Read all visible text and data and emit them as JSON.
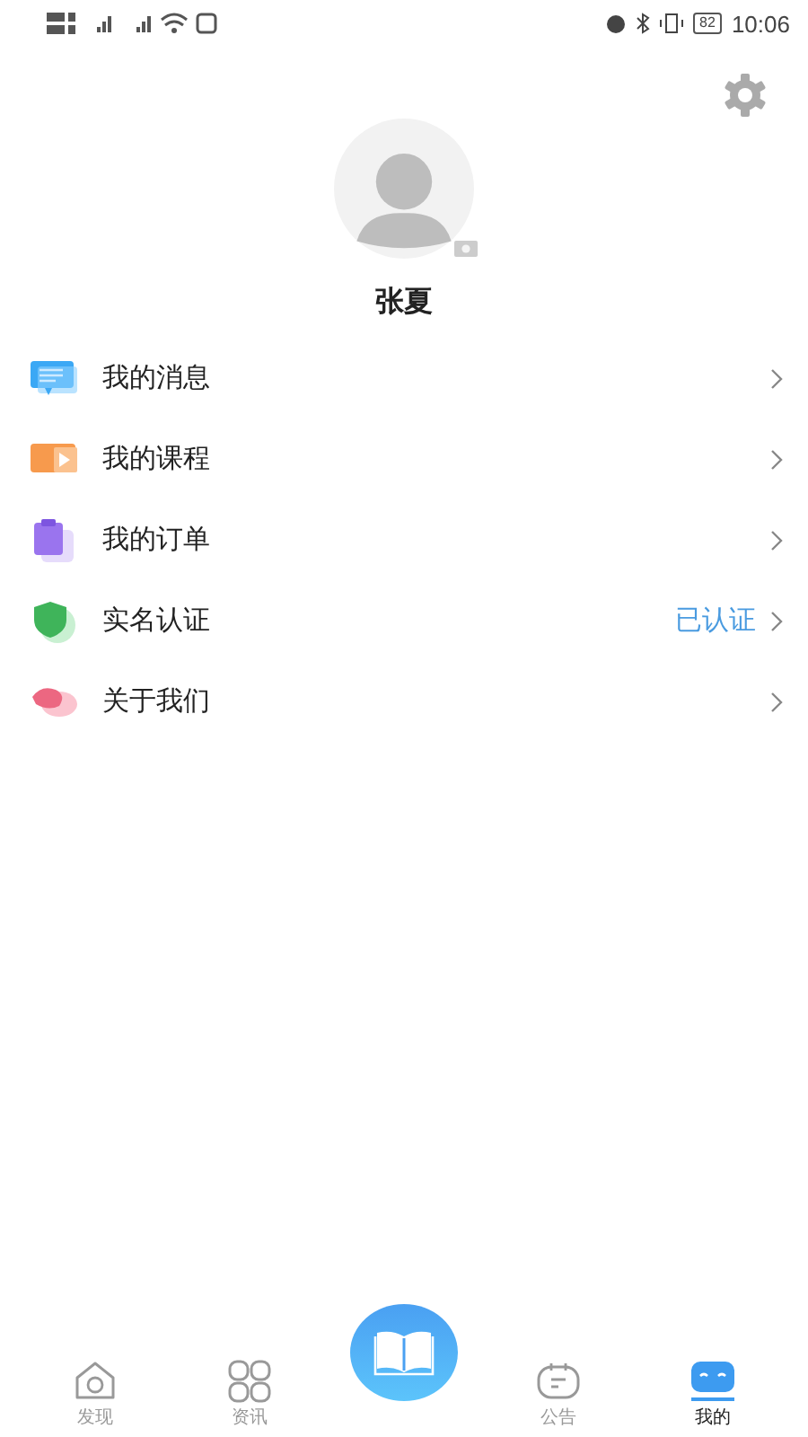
{
  "status_bar": {
    "battery": "82",
    "time": "10:06"
  },
  "profile": {
    "name": "张夏"
  },
  "menu": [
    {
      "kind": "message",
      "label": "我的消息"
    },
    {
      "kind": "course",
      "label": "我的课程"
    },
    {
      "kind": "order",
      "label": "我的订单"
    },
    {
      "kind": "verify",
      "label": "实名认证",
      "value": "已认证"
    },
    {
      "kind": "about",
      "label": "关于我们"
    }
  ],
  "tabs": [
    {
      "kind": "discover",
      "label": "发现",
      "selected": false
    },
    {
      "kind": "news",
      "label": "资讯",
      "selected": false
    },
    {
      "kind": "center"
    },
    {
      "kind": "notice",
      "label": "公告",
      "selected": false
    },
    {
      "kind": "mine",
      "label": "我的",
      "selected": true
    }
  ]
}
